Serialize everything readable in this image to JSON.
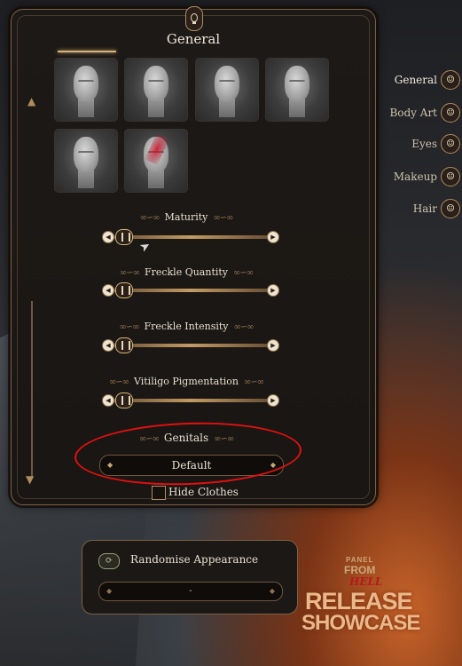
{
  "panel": {
    "title": "General"
  },
  "presets": [
    {
      "name": "face-preset-1"
    },
    {
      "name": "face-preset-2"
    },
    {
      "name": "face-preset-3"
    },
    {
      "name": "face-preset-4"
    },
    {
      "name": "face-preset-5"
    },
    {
      "name": "face-preset-6",
      "marking": "red"
    }
  ],
  "sliders": [
    {
      "label": "Maturity",
      "value": 0
    },
    {
      "label": "Freckle Quantity",
      "value": 0
    },
    {
      "label": "Freckle Intensity",
      "value": 0
    },
    {
      "label": "Vitiligo Pigmentation",
      "value": 0
    }
  ],
  "genitals": {
    "label": "Genitals",
    "selected": "Default"
  },
  "hide_clothes": {
    "label": "Hide Clothes",
    "checked": false
  },
  "tabs": [
    {
      "label": "General",
      "active": true
    },
    {
      "label": "Body Art",
      "active": false
    },
    {
      "label": "Eyes",
      "active": false
    },
    {
      "label": "Makeup",
      "active": false
    },
    {
      "label": "Hair",
      "active": false
    }
  ],
  "randomise": {
    "label": "Randomise Appearance",
    "field_value": "-"
  },
  "logo": {
    "line1": "PANEL",
    "line2": "FROM",
    "line3": "HELL",
    "line4": "RELEASE",
    "line5": "SHOWCASE"
  },
  "colors": {
    "accent_gold": "#b08d5e",
    "annotation_red": "#e01010"
  }
}
